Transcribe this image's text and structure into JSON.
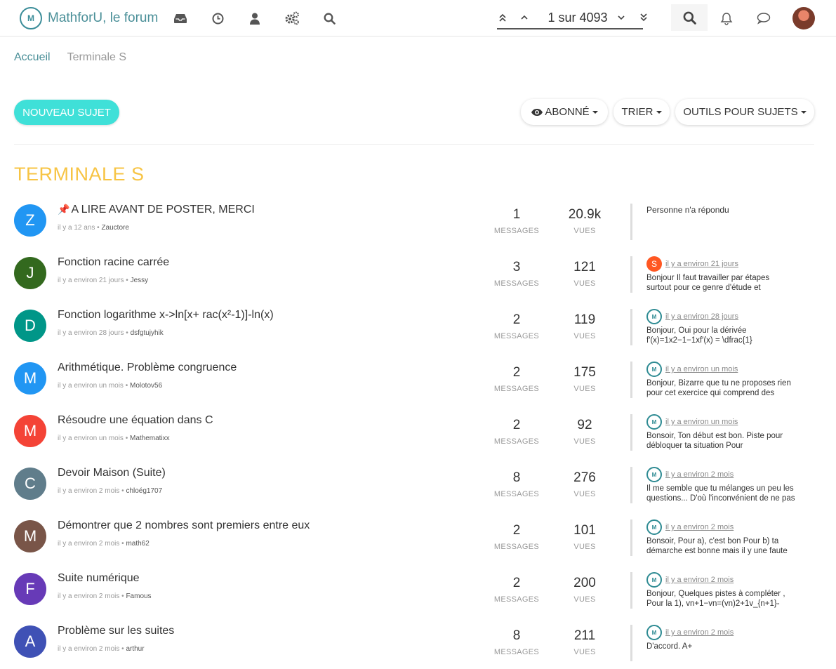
{
  "nav": {
    "brand_logo": "M",
    "brand_title": "MathforU, le forum",
    "icons": [
      "inbox-icon",
      "clock-icon",
      "user-icon",
      "gears-icon",
      "search-icon"
    ],
    "pager_text": "1 sur 4093"
  },
  "breadcrumb": {
    "home": "Accueil",
    "current": "Terminale S"
  },
  "actions": {
    "new_topic": "NOUVEAU SUJET",
    "watch": "ABONNÉ",
    "sort": "TRIER",
    "tools": "OUTILS POUR SUJETS"
  },
  "category": {
    "title": "TERMINALE S",
    "color": "#f7c444"
  },
  "labels": {
    "messages": "MESSAGES",
    "views": "VUES",
    "no_reply": "Personne n'a répondu"
  },
  "topics": [
    {
      "letter": "Z",
      "color": "#2196f3",
      "pinned": true,
      "title": "A LIRE AVANT DE POSTER, MERCI",
      "time": "il y a 12 ans",
      "author": "Zauctore",
      "messages": "1",
      "views": "20.9k",
      "last": null
    },
    {
      "letter": "J",
      "color": "#33691e",
      "pinned": false,
      "title": "Fonction racine carrée",
      "time": "il y a environ 21 jours",
      "author": "Jessy",
      "messages": "3",
      "views": "121",
      "last": {
        "avatar": "S",
        "avatar_color": "#ff5722",
        "time": "il y a environ 21 jours",
        "line1": "Bonjour Il faut travailler par étapes",
        "line2": "surtout pour ce genre d'étude et"
      }
    },
    {
      "letter": "D",
      "color": "#009688",
      "pinned": false,
      "title": "Fonction logarithme x->ln[x+ rac(x²-1)]-ln(x)",
      "time": "il y a environ 28 jours",
      "author": "dsfgtujyhik",
      "messages": "2",
      "views": "119",
      "last": {
        "avatar": "M",
        "avatar_color": "logo",
        "time": "il y a environ 28 jours",
        "line1": "Bonjour, Oui pour la dérivée",
        "line2": "f′(x)=1x2−1−1xf′(x) = \\dfrac{1}"
      }
    },
    {
      "letter": "M",
      "color": "#2196f3",
      "pinned": false,
      "title": "Arithmétique. Problème congruence",
      "time": "il y a environ un mois",
      "author": "Molotov56",
      "messages": "2",
      "views": "175",
      "last": {
        "avatar": "M",
        "avatar_color": "logo",
        "time": "il y a environ un mois",
        "line1": "Bonjour, Bizarre que tu ne proposes rien",
        "line2": "pour cet exercice qui comprend des"
      }
    },
    {
      "letter": "M",
      "color": "#f44336",
      "pinned": false,
      "title": "Résoudre une équation dans C",
      "time": "il y a environ un mois",
      "author": "Mathematixx",
      "messages": "2",
      "views": "92",
      "last": {
        "avatar": "M",
        "avatar_color": "logo",
        "time": "il y a environ un mois",
        "line1": "Bonsoir, Ton début est bon. Piste pour",
        "line2": "débloquer ta situation Pour"
      }
    },
    {
      "letter": "C",
      "color": "#607d8b",
      "pinned": false,
      "title": "Devoir Maison (Suite)",
      "time": "il y a environ 2 mois",
      "author": "chloég1707",
      "messages": "8",
      "views": "276",
      "last": {
        "avatar": "M",
        "avatar_color": "logo",
        "time": "il y a environ 2 mois",
        "line1": "Il me semble que tu mélanges un peu les",
        "line2": "questions... D'où l'inconvénient de ne pas"
      }
    },
    {
      "letter": "M",
      "color": "#795548",
      "pinned": false,
      "title": "Démontrer que 2 nombres sont premiers entre eux",
      "time": "il y a environ 2 mois",
      "author": "math62",
      "messages": "2",
      "views": "101",
      "last": {
        "avatar": "M",
        "avatar_color": "logo",
        "time": "il y a environ 2 mois",
        "line1": "Bonsoir, Pour a), c'est bon Pour b) ta",
        "line2": "démarche est bonne mais il y une faute"
      }
    },
    {
      "letter": "F",
      "color": "#673ab7",
      "pinned": false,
      "title": "Suite numérique",
      "time": "il y a environ 2 mois",
      "author": "Famous",
      "messages": "2",
      "views": "200",
      "last": {
        "avatar": "M",
        "avatar_color": "logo",
        "time": "il y a environ 2 mois",
        "line1": "Bonjour, Quelques pistes à compléter ,",
        "line2": "Pour la 1), vn+1−vn=(vn)2+1v_{n+1}-"
      }
    },
    {
      "letter": "A",
      "color": "#3f51b5",
      "pinned": false,
      "title": "Problème sur les suites",
      "time": "il y a environ 2 mois",
      "author": "arthur",
      "messages": "8",
      "views": "211",
      "last": {
        "avatar": "M",
        "avatar_color": "logo",
        "time": "il y a environ 2 mois",
        "line1": "D'accord. A+",
        "line2": ""
      }
    }
  ]
}
